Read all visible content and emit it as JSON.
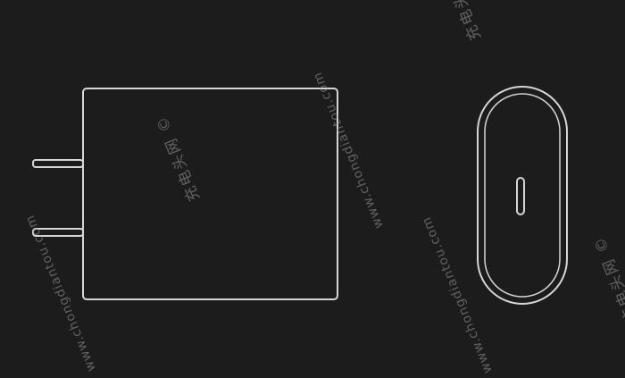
{
  "watermark": {
    "url": "www.chongdiantou.com",
    "cn": "充电头网 ©"
  },
  "colors": {
    "background": "#1c1c1c",
    "outline": "#d6d6d6"
  }
}
